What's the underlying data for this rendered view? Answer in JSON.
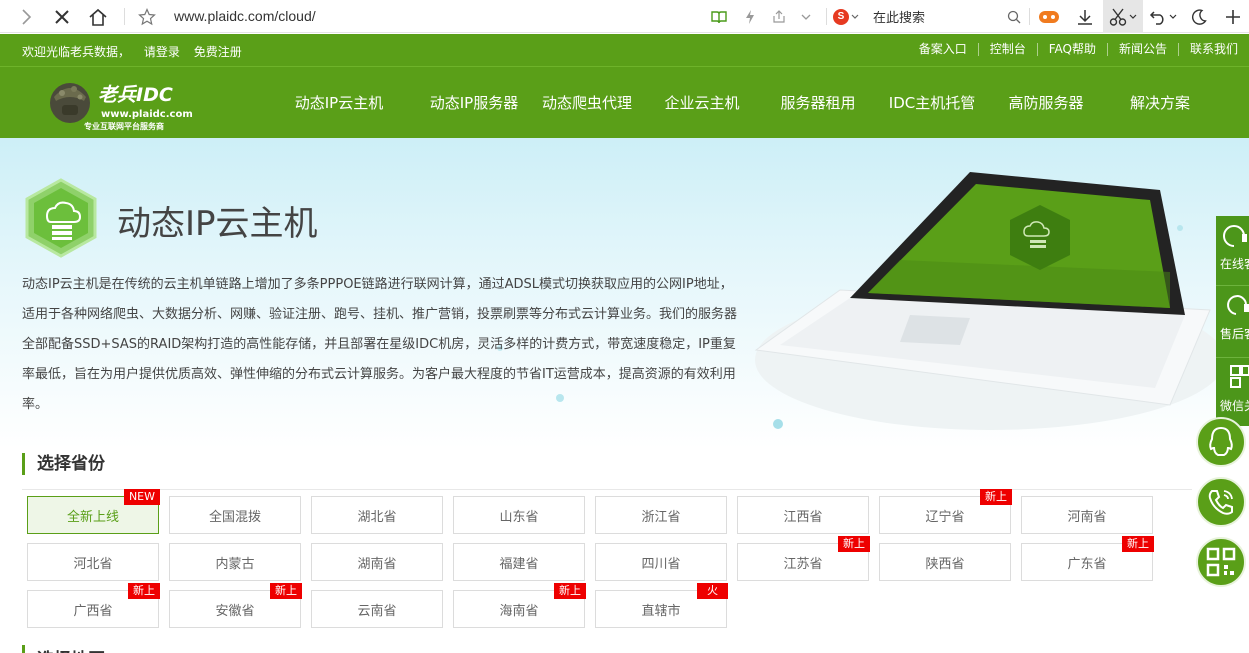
{
  "browser": {
    "url": "www.plaidc.com/cloud/",
    "search_placeholder": "在此搜索",
    "search_engine_letter": "S"
  },
  "topstrip": {
    "welcome": "欢迎光临老兵数据，",
    "login": "请登录",
    "register": "免费注册",
    "links": [
      "备案入口",
      "控制台",
      "FAQ帮助",
      "新闻公告",
      "联系我们"
    ]
  },
  "logo": {
    "brand": "老兵IDC",
    "url": "www.plaidc.com",
    "slogan": "专业互联网平台服务商"
  },
  "nav": {
    "items": [
      "动态IP云主机",
      "动态IP服务器",
      "动态爬虫代理",
      "企业云主机",
      "服务器租用",
      "IDC主机托管",
      "高防服务器",
      "解决方案"
    ]
  },
  "hero": {
    "title": "动态IP云主机",
    "description": "动态IP云主机是在传统的云主机单链路上增加了多条PPPOE链路进行联网计算，通过ADSL模式切换获取应用的公网IP地址，适用于各种网络爬虫、大数据分析、网赚、验证注册、跑号、挂机、推广营销，投票刷票等分布式云计算业务。我们的服务器全部配备SSD+SAS的RAID架构打造的高性能存储，并且部署在星级IDC机房，灵活多样的计费方式，带宽速度稳定，IP重复率最低，旨在为用户提供优质高效、弹性伸缩的分布式云计算服务。为客户最大程度的节省IT运营成本，提高资源的有效利用率。"
  },
  "side": {
    "items": [
      "在线客服",
      "售后客服",
      "微信关注"
    ]
  },
  "province": {
    "title": "选择省份",
    "items": [
      {
        "name": "全新上线",
        "badge": "NEW",
        "selected": true
      },
      {
        "name": "全国混拨",
        "badge": ""
      },
      {
        "name": "湖北省",
        "badge": ""
      },
      {
        "name": "山东省",
        "badge": ""
      },
      {
        "name": "浙江省",
        "badge": ""
      },
      {
        "name": "江西省",
        "badge": ""
      },
      {
        "name": "辽宁省",
        "badge": "新上"
      },
      {
        "name": "河南省",
        "badge": ""
      },
      {
        "name": "河北省",
        "badge": ""
      },
      {
        "name": "内蒙古",
        "badge": ""
      },
      {
        "name": "湖南省",
        "badge": ""
      },
      {
        "name": "福建省",
        "badge": ""
      },
      {
        "name": "四川省",
        "badge": ""
      },
      {
        "name": "江苏省",
        "badge": "新上"
      },
      {
        "name": "陕西省",
        "badge": ""
      },
      {
        "name": "广东省",
        "badge": "新上"
      },
      {
        "name": "广西省",
        "badge": "新上"
      },
      {
        "name": "安徽省",
        "badge": "新上"
      },
      {
        "name": "云南省",
        "badge": ""
      },
      {
        "name": "海南省",
        "badge": "新上"
      },
      {
        "name": "直辖市",
        "badge": "火"
      }
    ]
  },
  "next_section_title": "选择地区",
  "colors": {
    "brand_green": "#5a9f18",
    "badge_red": "#e00000"
  }
}
